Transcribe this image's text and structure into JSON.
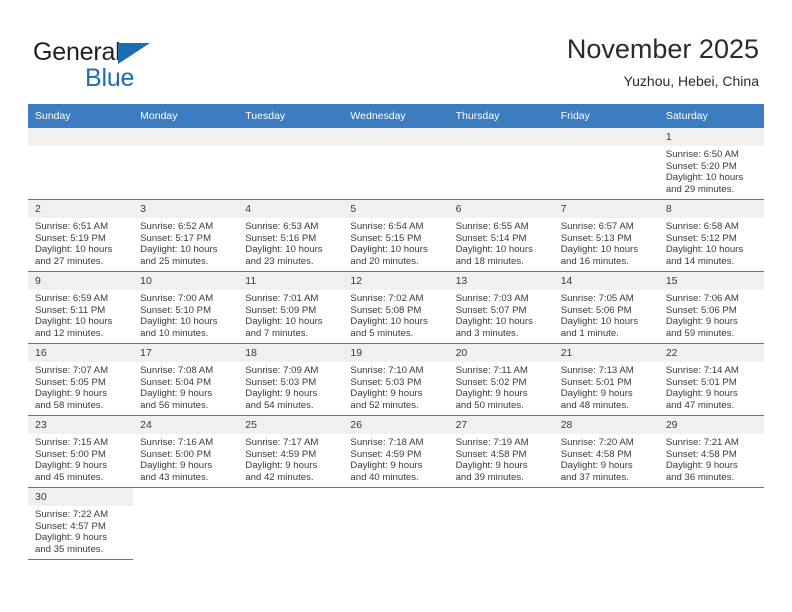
{
  "brand": {
    "word1": "General",
    "word2": "Blue",
    "flag_icon": "triangle-flag-icon",
    "accent_color": "#1c6cb3"
  },
  "header": {
    "title": "November 2025",
    "location": "Yuzhou, Hebei, China"
  },
  "calendar": {
    "header_bg": "#3b7dc0",
    "daynum_bg": "#f0f0f0",
    "weekdays": [
      "Sunday",
      "Monday",
      "Tuesday",
      "Wednesday",
      "Thursday",
      "Friday",
      "Saturday"
    ],
    "weeks": [
      [
        {
          "empty": true
        },
        {
          "empty": true
        },
        {
          "empty": true
        },
        {
          "empty": true
        },
        {
          "empty": true
        },
        {
          "empty": true
        },
        {
          "day": "1",
          "sunrise": "Sunrise: 6:50 AM",
          "sunset": "Sunset: 5:20 PM",
          "daylight1": "Daylight: 10 hours",
          "daylight2": "and 29 minutes."
        }
      ],
      [
        {
          "day": "2",
          "sunrise": "Sunrise: 6:51 AM",
          "sunset": "Sunset: 5:19 PM",
          "daylight1": "Daylight: 10 hours",
          "daylight2": "and 27 minutes."
        },
        {
          "day": "3",
          "sunrise": "Sunrise: 6:52 AM",
          "sunset": "Sunset: 5:17 PM",
          "daylight1": "Daylight: 10 hours",
          "daylight2": "and 25 minutes."
        },
        {
          "day": "4",
          "sunrise": "Sunrise: 6:53 AM",
          "sunset": "Sunset: 5:16 PM",
          "daylight1": "Daylight: 10 hours",
          "daylight2": "and 23 minutes."
        },
        {
          "day": "5",
          "sunrise": "Sunrise: 6:54 AM",
          "sunset": "Sunset: 5:15 PM",
          "daylight1": "Daylight: 10 hours",
          "daylight2": "and 20 minutes."
        },
        {
          "day": "6",
          "sunrise": "Sunrise: 6:55 AM",
          "sunset": "Sunset: 5:14 PM",
          "daylight1": "Daylight: 10 hours",
          "daylight2": "and 18 minutes."
        },
        {
          "day": "7",
          "sunrise": "Sunrise: 6:57 AM",
          "sunset": "Sunset: 5:13 PM",
          "daylight1": "Daylight: 10 hours",
          "daylight2": "and 16 minutes."
        },
        {
          "day": "8",
          "sunrise": "Sunrise: 6:58 AM",
          "sunset": "Sunset: 5:12 PM",
          "daylight1": "Daylight: 10 hours",
          "daylight2": "and 14 minutes."
        }
      ],
      [
        {
          "day": "9",
          "sunrise": "Sunrise: 6:59 AM",
          "sunset": "Sunset: 5:11 PM",
          "daylight1": "Daylight: 10 hours",
          "daylight2": "and 12 minutes."
        },
        {
          "day": "10",
          "sunrise": "Sunrise: 7:00 AM",
          "sunset": "Sunset: 5:10 PM",
          "daylight1": "Daylight: 10 hours",
          "daylight2": "and 10 minutes."
        },
        {
          "day": "11",
          "sunrise": "Sunrise: 7:01 AM",
          "sunset": "Sunset: 5:09 PM",
          "daylight1": "Daylight: 10 hours",
          "daylight2": "and 7 minutes."
        },
        {
          "day": "12",
          "sunrise": "Sunrise: 7:02 AM",
          "sunset": "Sunset: 5:08 PM",
          "daylight1": "Daylight: 10 hours",
          "daylight2": "and 5 minutes."
        },
        {
          "day": "13",
          "sunrise": "Sunrise: 7:03 AM",
          "sunset": "Sunset: 5:07 PM",
          "daylight1": "Daylight: 10 hours",
          "daylight2": "and 3 minutes."
        },
        {
          "day": "14",
          "sunrise": "Sunrise: 7:05 AM",
          "sunset": "Sunset: 5:06 PM",
          "daylight1": "Daylight: 10 hours",
          "daylight2": "and 1 minute."
        },
        {
          "day": "15",
          "sunrise": "Sunrise: 7:06 AM",
          "sunset": "Sunset: 5:06 PM",
          "daylight1": "Daylight: 9 hours",
          "daylight2": "and 59 minutes."
        }
      ],
      [
        {
          "day": "16",
          "sunrise": "Sunrise: 7:07 AM",
          "sunset": "Sunset: 5:05 PM",
          "daylight1": "Daylight: 9 hours",
          "daylight2": "and 58 minutes."
        },
        {
          "day": "17",
          "sunrise": "Sunrise: 7:08 AM",
          "sunset": "Sunset: 5:04 PM",
          "daylight1": "Daylight: 9 hours",
          "daylight2": "and 56 minutes."
        },
        {
          "day": "18",
          "sunrise": "Sunrise: 7:09 AM",
          "sunset": "Sunset: 5:03 PM",
          "daylight1": "Daylight: 9 hours",
          "daylight2": "and 54 minutes."
        },
        {
          "day": "19",
          "sunrise": "Sunrise: 7:10 AM",
          "sunset": "Sunset: 5:03 PM",
          "daylight1": "Daylight: 9 hours",
          "daylight2": "and 52 minutes."
        },
        {
          "day": "20",
          "sunrise": "Sunrise: 7:11 AM",
          "sunset": "Sunset: 5:02 PM",
          "daylight1": "Daylight: 9 hours",
          "daylight2": "and 50 minutes."
        },
        {
          "day": "21",
          "sunrise": "Sunrise: 7:13 AM",
          "sunset": "Sunset: 5:01 PM",
          "daylight1": "Daylight: 9 hours",
          "daylight2": "and 48 minutes."
        },
        {
          "day": "22",
          "sunrise": "Sunrise: 7:14 AM",
          "sunset": "Sunset: 5:01 PM",
          "daylight1": "Daylight: 9 hours",
          "daylight2": "and 47 minutes."
        }
      ],
      [
        {
          "day": "23",
          "sunrise": "Sunrise: 7:15 AM",
          "sunset": "Sunset: 5:00 PM",
          "daylight1": "Daylight: 9 hours",
          "daylight2": "and 45 minutes."
        },
        {
          "day": "24",
          "sunrise": "Sunrise: 7:16 AM",
          "sunset": "Sunset: 5:00 PM",
          "daylight1": "Daylight: 9 hours",
          "daylight2": "and 43 minutes."
        },
        {
          "day": "25",
          "sunrise": "Sunrise: 7:17 AM",
          "sunset": "Sunset: 4:59 PM",
          "daylight1": "Daylight: 9 hours",
          "daylight2": "and 42 minutes."
        },
        {
          "day": "26",
          "sunrise": "Sunrise: 7:18 AM",
          "sunset": "Sunset: 4:59 PM",
          "daylight1": "Daylight: 9 hours",
          "daylight2": "and 40 minutes."
        },
        {
          "day": "27",
          "sunrise": "Sunrise: 7:19 AM",
          "sunset": "Sunset: 4:58 PM",
          "daylight1": "Daylight: 9 hours",
          "daylight2": "and 39 minutes."
        },
        {
          "day": "28",
          "sunrise": "Sunrise: 7:20 AM",
          "sunset": "Sunset: 4:58 PM",
          "daylight1": "Daylight: 9 hours",
          "daylight2": "and 37 minutes."
        },
        {
          "day": "29",
          "sunrise": "Sunrise: 7:21 AM",
          "sunset": "Sunset: 4:58 PM",
          "daylight1": "Daylight: 9 hours",
          "daylight2": "and 36 minutes."
        }
      ],
      [
        {
          "day": "30",
          "sunrise": "Sunrise: 7:22 AM",
          "sunset": "Sunset: 4:57 PM",
          "daylight1": "Daylight: 9 hours",
          "daylight2": "and 35 minutes."
        },
        {
          "blank": true
        },
        {
          "blank": true
        },
        {
          "blank": true
        },
        {
          "blank": true
        },
        {
          "blank": true
        },
        {
          "blank": true
        }
      ]
    ]
  }
}
